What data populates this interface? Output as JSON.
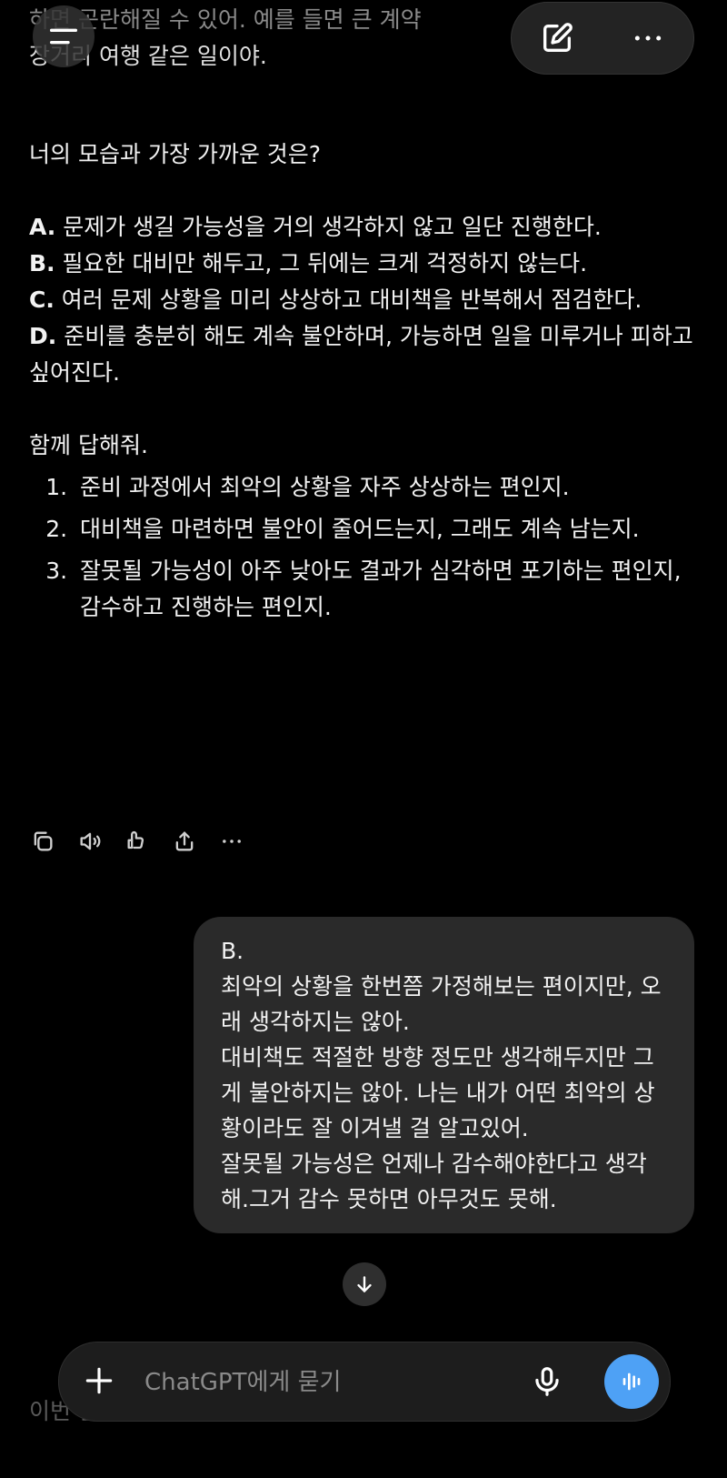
{
  "prev_message": {
    "line1": "하면 곤란해질 수 있어. 예를 들면 큰 계약",
    "line2": "장거리 여행 같은 일이야."
  },
  "question": "너의 모습과 가장 가까운 것은?",
  "options": [
    {
      "letter": "A.",
      "text": " 문제가 생길 가능성을 거의 생각하지 않고 일단 진행한다."
    },
    {
      "letter": "B.",
      "text": " 필요한 대비만 해두고, 그 뒤에는 크게 걱정하지 않는다."
    },
    {
      "letter": "C.",
      "text": " 여러 문제 상황을 미리 상상하고 대비책을 반복해서 점검한다."
    },
    {
      "letter": "D.",
      "text": " 준비를 충분히 해도 계속 불안하며, 가능하면 일을 미루거나 피하고 싶어진다."
    }
  ],
  "together_prompt": "함께 답해줘.",
  "follow_ups": [
    "준비 과정에서 최악의 상황을 자주 상상하는 편인지.",
    "대비책을 마련하면 불안이 줄어드는지, 그래도 계속 남는지.",
    "잘못될 가능성이 아주 낮아도 결과가 심각하면 포기하는 편인지, 감수하고 진행하는 편인지."
  ],
  "action_icons": [
    "copy-icon",
    "speaker-icon",
    "thumbs-icon",
    "share-icon",
    "more-icon"
  ],
  "user_reply": "B.\n최악의 상황을 한번쯤 가정해보는 편이지만, 오래 생각하지는 않아.\n대비책도 적절한 방향 정도만 생각해두지만 그게 불안하지는 않아. 나는 내가 어떤 최악의 상황이라도 잘 이겨낼 걸 알고있어.\n잘못될 가능성은 언제나 감수해야한다고 생각해.그거 감수 못하면 아무것도 못해.",
  "composer": {
    "placeholder": "ChatGPT에게 묻기"
  },
  "next_message_partial": "이번 답변으로 위험회피에 대한 기질은 꽤 명확해졌어.",
  "colors": {
    "background": "#000000",
    "bubble": "#2a2a2a",
    "voice_button": "#4ea1f5"
  }
}
